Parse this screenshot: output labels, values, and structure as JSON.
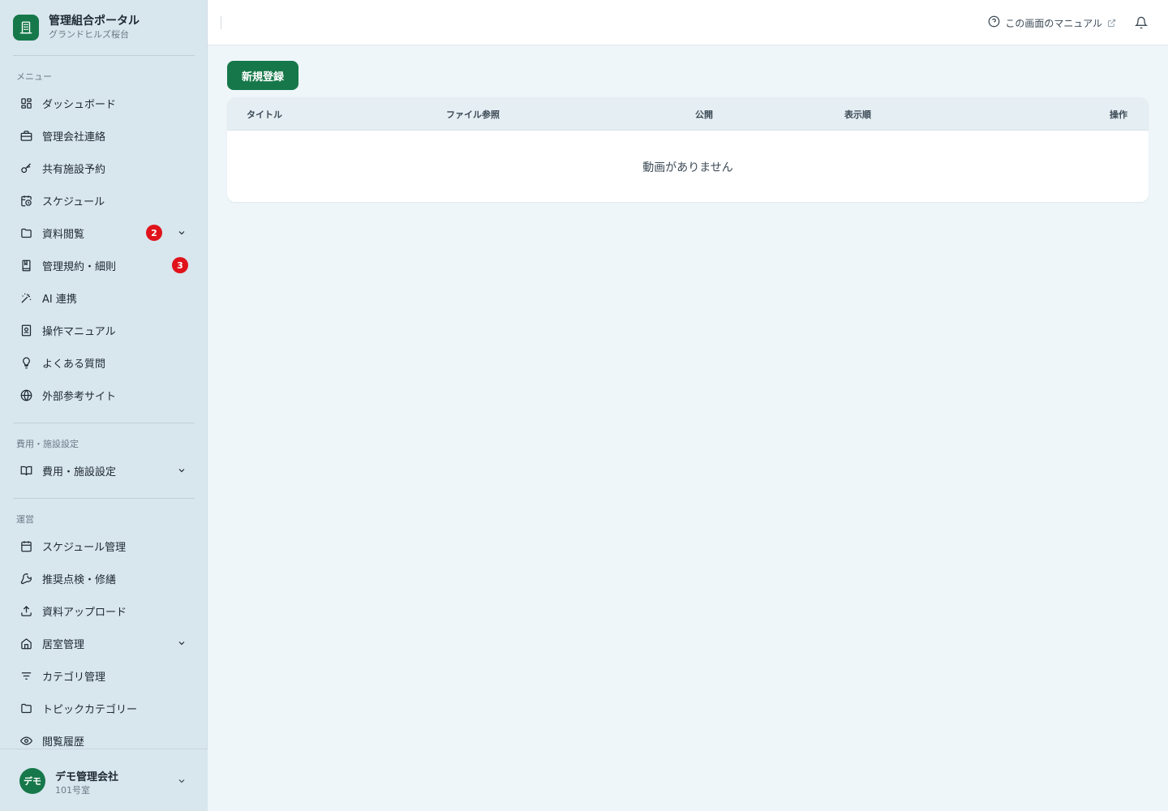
{
  "brand": {
    "title": "管理組合ポータル",
    "subtitle": "グランドヒルズ桜台"
  },
  "sidebar": {
    "menu_label": "メニュー",
    "menu_items": [
      {
        "label": "ダッシュボード",
        "icon": "dashboard-icon"
      },
      {
        "label": "管理会社連絡",
        "icon": "briefcase-icon"
      },
      {
        "label": "共有施設予約",
        "icon": "key-icon"
      },
      {
        "label": "スケジュール",
        "icon": "calendar-clock-icon"
      },
      {
        "label": "資料閲覧",
        "icon": "folder-icon",
        "badge": "2",
        "expandable": true
      },
      {
        "label": "管理規約・細則",
        "icon": "book-icon",
        "badge": "3"
      },
      {
        "label": "AI 連携",
        "icon": "magic-wand-icon"
      },
      {
        "label": "操作マニュアル",
        "icon": "manual-icon"
      },
      {
        "label": "よくある質問",
        "icon": "lightbulb-icon"
      },
      {
        "label": "外部参考サイト",
        "icon": "globe-icon"
      }
    ],
    "fees_label": "費用・施設設定",
    "fees_items": [
      {
        "label": "費用・施設設定",
        "icon": "open-book-icon",
        "expandable": true
      }
    ],
    "ops_label": "運営",
    "ops_items": [
      {
        "label": "スケジュール管理",
        "icon": "calendar-icon"
      },
      {
        "label": "推奨点検・修繕",
        "icon": "wrench-icon"
      },
      {
        "label": "資料アップロード",
        "icon": "upload-icon"
      },
      {
        "label": "居室管理",
        "icon": "home-icon",
        "expandable": true
      },
      {
        "label": "カテゴリ管理",
        "icon": "filter-icon"
      },
      {
        "label": "トピックカテゴリー",
        "icon": "folder-icon"
      },
      {
        "label": "閲覧履歴",
        "icon": "eye-icon"
      }
    ]
  },
  "user": {
    "avatar": "デモ",
    "name": "デモ管理会社",
    "room": "101号室"
  },
  "header": {
    "manual_link": "この画面のマニュアル"
  },
  "main": {
    "new_button": "新規登録",
    "table": {
      "columns": [
        "タイトル",
        "ファイル参照",
        "公開",
        "表示順",
        "操作"
      ],
      "empty_message": "動画がありません"
    }
  },
  "colors": {
    "brand_green": "#16784a",
    "badge_red": "#e0131b",
    "sidebar_bg": "#d8e6ee",
    "main_bg": "#eef6fa"
  }
}
